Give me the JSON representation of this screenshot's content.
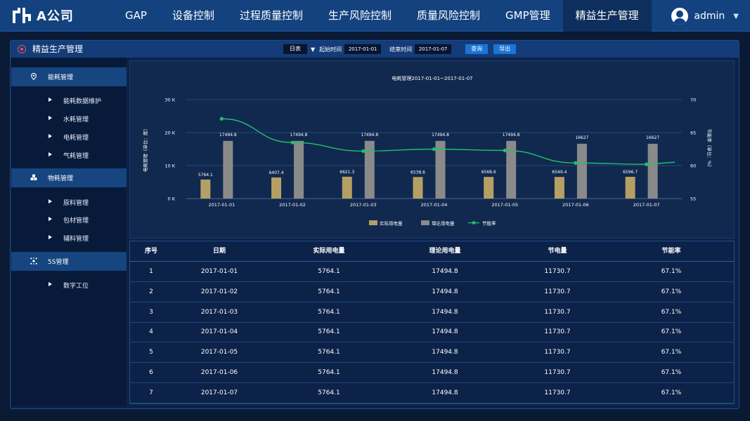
{
  "app": {
    "logo_text": "A公司"
  },
  "nav": {
    "items": [
      "GAP",
      "设备控制",
      "过程质量控制",
      "生产风险控制",
      "质量风险控制",
      "GMP管理",
      "精益生产管理"
    ],
    "active": 6
  },
  "user": {
    "name": "admin",
    "caret": "▼"
  },
  "panel": {
    "title": "精益生产管理"
  },
  "filters": {
    "period": "日表",
    "period_caret": "▼",
    "start_label": "起始时间",
    "start_value": "2017-01-01",
    "end_label": "结束时间",
    "end_value": "2017-01-07",
    "query_label": "查询",
    "export_label": "导出"
  },
  "sidebar": {
    "groups": [
      {
        "label": "能耗管理",
        "icon": "location-pin-icon",
        "items": [
          "能耗数据维护",
          "水耗管理",
          "电耗管理",
          "气耗管理"
        ]
      },
      {
        "label": "物耗管理",
        "icon": "cubes-icon",
        "items": [
          "原料管理",
          "包材管理",
          "辅料管理"
        ]
      },
      {
        "label": "5S管理",
        "icon": "network-icon",
        "items": [
          "数字工位"
        ]
      }
    ]
  },
  "chart_data": {
    "type": "bar",
    "title": "电耗管理2017-01-01~2017-01-07",
    "categories": [
      "2017-01-01",
      "2017-01-02",
      "2017-01-03",
      "2017-01-04",
      "2017-01-05",
      "2017-01-06",
      "2017-01-07"
    ],
    "ylabel": "电耗管理（单位：度）",
    "y2label": "节能率（单位：%）",
    "ylim": [
      0,
      30000
    ],
    "y2lim": [
      55,
      70
    ],
    "yticks": [
      "0 K",
      "10 K",
      "20 K",
      "30 K"
    ],
    "y2ticks": [
      "55",
      "60",
      "65",
      "70"
    ],
    "series": [
      {
        "name": "实际用电量",
        "type": "bar",
        "color": "#b5a064",
        "values": [
          5764.1,
          6407.4,
          6621.3,
          6538.6,
          6568.6,
          6549.4,
          6596.7
        ],
        "labels": [
          "5764.1",
          "6407.4",
          "6621.3",
          "6538.6",
          "6568.6",
          "6549.4",
          "6596.7"
        ]
      },
      {
        "name": "理论用电量",
        "type": "bar",
        "color": "#8a8a8a",
        "values": [
          17494.8,
          17494.8,
          17494.8,
          17494.8,
          17494.8,
          16627,
          16627
        ],
        "labels": [
          "17494.8",
          "17494.8",
          "17494.8",
          "17494.8",
          "17494.8",
          "16627",
          "16627"
        ]
      },
      {
        "name": "节能率",
        "type": "line",
        "axis": "right",
        "color": "#21c06b",
        "values": [
          67.1,
          63.5,
          62.2,
          62.5,
          62.3,
          60.4,
          60.2
        ]
      }
    ],
    "legend_position": "bottom",
    "grid": true
  },
  "table": {
    "columns": [
      "序号",
      "日期",
      "实际用电量",
      "理论用电量",
      "节电量",
      "节能率"
    ],
    "rows": [
      [
        "1",
        "2017-01-01",
        "5764.1",
        "17494.8",
        "11730.7",
        "67.1%"
      ],
      [
        "2",
        "2017-01-02",
        "5764.1",
        "17494.8",
        "11730.7",
        "67.1%"
      ],
      [
        "3",
        "2017-01-03",
        "5764.1",
        "17494.8",
        "11730.7",
        "67.1%"
      ],
      [
        "4",
        "2017-01-04",
        "5764.1",
        "17494.8",
        "11730.7",
        "67.1%"
      ],
      [
        "5",
        "2017-01-05",
        "5764.1",
        "17494.8",
        "11730.7",
        "67.1%"
      ],
      [
        "6",
        "2017-01-06",
        "5764.1",
        "17494.8",
        "11730.7",
        "67.1%"
      ],
      [
        "7",
        "2017-01-07",
        "5764.1",
        "17494.8",
        "11730.7",
        "67.1%"
      ]
    ]
  }
}
